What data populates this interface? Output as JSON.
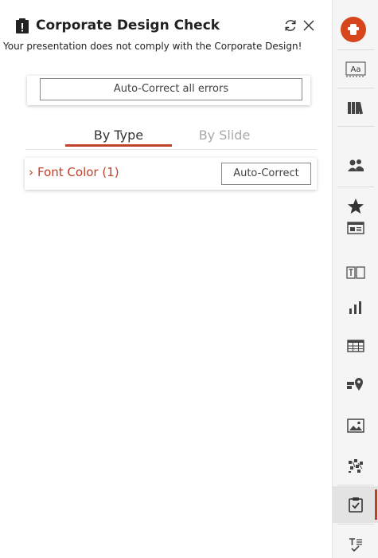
{
  "panel": {
    "title": "Corporate Design Check",
    "message": "Your presentation does not comply with the Corporate Design!",
    "autocorrect_all_label": "Auto-Correct all errors",
    "tabs": [
      {
        "label": "By Type",
        "active": true
      },
      {
        "label": "By Slide",
        "active": false
      }
    ],
    "groups": [
      {
        "label": "Font Color (1)",
        "action_label": "Auto-Correct"
      }
    ]
  },
  "sidebar": {
    "logo_icon": "brand-logo-icon",
    "items": [
      {
        "icon": "font-icon",
        "label_text": "Aa"
      },
      {
        "icon": "library-icon"
      },
      {
        "icon": "people-icon"
      },
      {
        "icon": "star-icon"
      },
      {
        "icon": "layout-icon"
      },
      {
        "icon": "text-box-icon"
      },
      {
        "icon": "chart-icon"
      },
      {
        "icon": "table-icon"
      },
      {
        "icon": "location-icon"
      },
      {
        "icon": "picture-icon"
      },
      {
        "icon": "pattern-icon"
      },
      {
        "icon": "checklist-icon",
        "active": true
      },
      {
        "icon": "text-check-icon"
      }
    ]
  },
  "colors": {
    "accent": "#c0402a",
    "logo": "#d7451c"
  }
}
